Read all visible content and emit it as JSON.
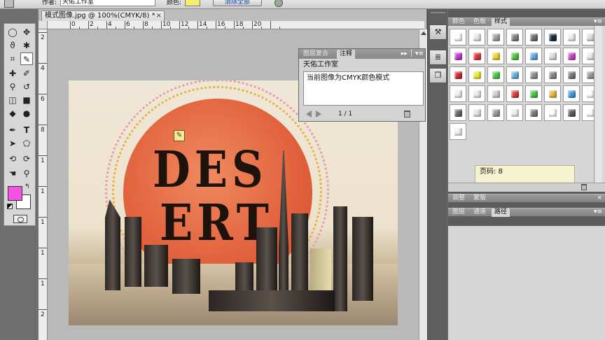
{
  "options_bar": {
    "author_label": "作者:",
    "author_value": "天佑工作室",
    "color_label": "颜色:",
    "color_value": "#f3ef6e",
    "clear_all_label": "清除全部"
  },
  "toolbox": {
    "foreground_color": "#f552e3",
    "background_color": "#ffffff",
    "tools": [
      "marquee",
      "move",
      "lasso",
      "magic-wand",
      "crop",
      "note",
      "healing-brush",
      "brush",
      "clone-stamp",
      "history-brush",
      "eraser",
      "gradient",
      "blur",
      "dodge",
      "pen",
      "type",
      "path-selection",
      "shape",
      "3d-rotate",
      "3d-orbit",
      "hand",
      "zoom"
    ]
  },
  "document": {
    "tab_title": "模式图像.jpg @ 100%(CMYK/8) *",
    "close_label": "×",
    "ruler_top": [
      "0",
      "2",
      "4",
      "6",
      "8",
      "10",
      "12",
      "14",
      "16",
      "18",
      "20"
    ],
    "ruler_left": [
      "2",
      "4",
      "6",
      "8",
      "1",
      "1",
      "1",
      "1",
      "1",
      "2"
    ],
    "artwork": {
      "title_line1": "DES",
      "title_line2": "ERT"
    }
  },
  "notes_panel": {
    "tabs": [
      "图层复合",
      "注释"
    ],
    "active_tab": "注释",
    "menu_glyph": "▸▸ │ ▾≡",
    "author": "天佑工作室",
    "note_text": "当前图像为CMYK颜色模式",
    "counter": "1 / 1"
  },
  "right_panels": {
    "top_tabs": [
      "颜色",
      "色板",
      "样式"
    ],
    "active_top_tab": "样式",
    "tooltip": "页码: 8",
    "adjust_tabs": [
      "调整",
      "蒙版"
    ],
    "layer_tabs": [
      "图层",
      "通道",
      "路径"
    ],
    "active_layer_tab": "路径",
    "menu_glyph": "▾≡",
    "close_glyph": "×"
  },
  "style_swatches": [
    [
      "#ffffff",
      "#e8e8e8",
      "#a0a0a0",
      "#808080",
      "#6f6f6f",
      "#1c2f3f",
      "#eeeeee",
      "#dddddd"
    ],
    [
      "#c23ad6",
      "#e63333",
      "#f2d526",
      "#52c63a",
      "#63a7e8",
      "#dcdcdc",
      "#cf43c5",
      "#e8e8e8"
    ],
    [
      "#d42a2a",
      "#eaea2c",
      "#4fc846",
      "#5fb1e5",
      "#8f8f8f",
      "#8a8a8a",
      "#7a7a7a",
      "#999999"
    ],
    [
      "#f0f0f0",
      "#ececec",
      "#cfcfcf",
      "#e23c3c",
      "#47c946",
      "#eab93a",
      "#3f9be2",
      "#ffffff"
    ],
    [
      "#6a6a6a",
      "#e6e6e6",
      "#9b9b9b",
      "#efefef",
      "#7d7d7d",
      "#ffffff",
      "#5d5d5d",
      "#ffffff"
    ],
    [
      "#f2f2f2"
    ]
  ]
}
